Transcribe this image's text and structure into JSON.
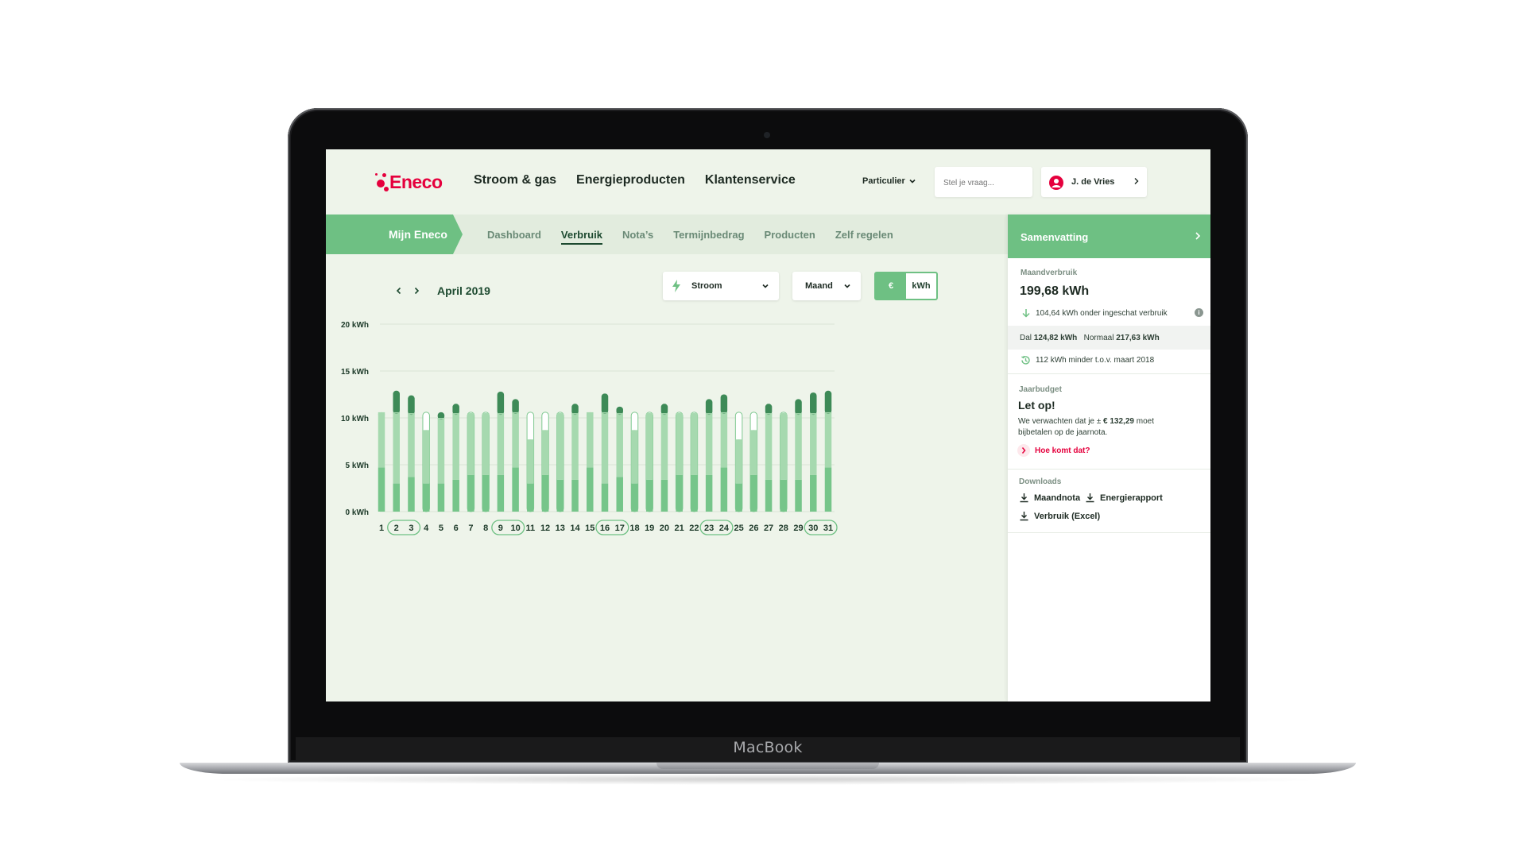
{
  "brand": {
    "device": "MacBook"
  },
  "header": {
    "logo_text": "Eneco",
    "nav": [
      "Stroom & gas",
      "Energieproducten",
      "Klantenservice"
    ],
    "segment": "Particulier",
    "search_placeholder": "Stel je vraag...",
    "user_name": "J. de Vries"
  },
  "subnav": {
    "home": "Mijn Eneco",
    "tabs": [
      "Dashboard",
      "Verbruik",
      "Nota’s",
      "Termijnbedrag",
      "Producten",
      "Zelf regelen"
    ],
    "active": "Verbruik"
  },
  "controls": {
    "month": "April 2019",
    "energy_type": "Stroom",
    "period": "Maand",
    "unit_euro": "€",
    "unit_kwh": "kWh",
    "active_unit": "€"
  },
  "chart_data": {
    "type": "bar",
    "yticks": [
      "20 kWh",
      "15 kWh",
      "10 kWh",
      "5 kWh",
      "0 kWh"
    ],
    "ylim": [
      0,
      20
    ],
    "categories": [
      "1",
      "2",
      "3",
      "4",
      "5",
      "6",
      "7",
      "8",
      "9",
      "10",
      "11",
      "12",
      "13",
      "14",
      "15",
      "16",
      "17",
      "18",
      "19",
      "20",
      "21",
      "22",
      "23",
      "24",
      "25",
      "26",
      "27",
      "28",
      "29",
      "30",
      "31"
    ],
    "highlighted_days": [
      "2",
      "3",
      "9",
      "10",
      "16",
      "17",
      "23",
      "24",
      "30",
      "31"
    ],
    "series": [
      {
        "values": [
          4.7,
          3.0,
          3.7,
          3.0,
          3.0,
          3.4,
          3.9,
          3.9,
          3.9,
          4.7,
          3.0,
          3.9,
          3.4,
          3.4,
          4.7,
          3.0,
          3.7,
          3.0,
          3.4,
          3.4,
          3.9,
          3.9,
          3.9,
          4.7,
          3.0,
          3.9,
          3.4,
          3.4,
          3.4,
          3.9,
          4.7
        ]
      },
      {
        "values": [
          5.9,
          7.6,
          6.8,
          5.7,
          7.0,
          7.1,
          6.6,
          6.6,
          6.6,
          5.9,
          4.7,
          4.8,
          7.1,
          7.1,
          5.9,
          7.6,
          6.8,
          5.7,
          7.1,
          7.1,
          6.6,
          6.6,
          6.6,
          5.9,
          4.7,
          4.8,
          7.1,
          7.1,
          7.1,
          6.6,
          5.9
        ]
      },
      {
        "values": [
          0,
          2.3,
          1.9,
          0,
          0.6,
          1.0,
          0,
          0,
          2.3,
          1.4,
          0,
          0,
          0,
          1.0,
          0,
          2.0,
          0.7,
          0,
          0,
          1.0,
          0,
          0,
          1.5,
          1.9,
          0,
          0,
          1.0,
          0,
          1.5,
          2.2,
          2.3
        ]
      }
    ],
    "estimated": [
      10.6,
      10.6,
      10.6,
      10.6,
      10.6,
      10.6,
      10.6,
      10.6,
      10.6,
      10.6,
      10.6,
      10.6,
      10.6,
      10.6,
      10.6,
      10.6,
      10.6,
      10.6,
      10.6,
      10.6,
      10.6,
      10.6,
      10.6,
      10.6,
      10.6,
      10.6,
      10.6,
      10.6,
      10.6,
      10.6,
      10.6
    ]
  },
  "summary": {
    "title": "Samenvatting",
    "month_label": "Maandverbruik",
    "month_value": "199,68 kWh",
    "under_estimate": "104,64 kWh onder ingeschat verbruik",
    "dal_label": "Dal",
    "dal_value": "124,82 kWh",
    "normaal_label": "Normaal",
    "normaal_value": "217,63 kWh",
    "compare": "112 kWh minder t.o.v. maart 2018",
    "budget_label": "Jaarbudget",
    "budget_title": "Let op!",
    "budget_text_1": "We verwachten dat je ±",
    "budget_amount": "€ 132,29",
    "budget_text_2": "moet",
    "budget_text_3": "bijbetalen op de jaarnota.",
    "budget_link": "Hoe komt dat?",
    "downloads_label": "Downloads",
    "downloads": [
      "Maandnota",
      "Energierapport",
      "Verbruik (Excel)"
    ]
  },
  "colors": {
    "accent": "#6ec083",
    "brand": "#e5003d",
    "dark": "#1d4a30"
  }
}
